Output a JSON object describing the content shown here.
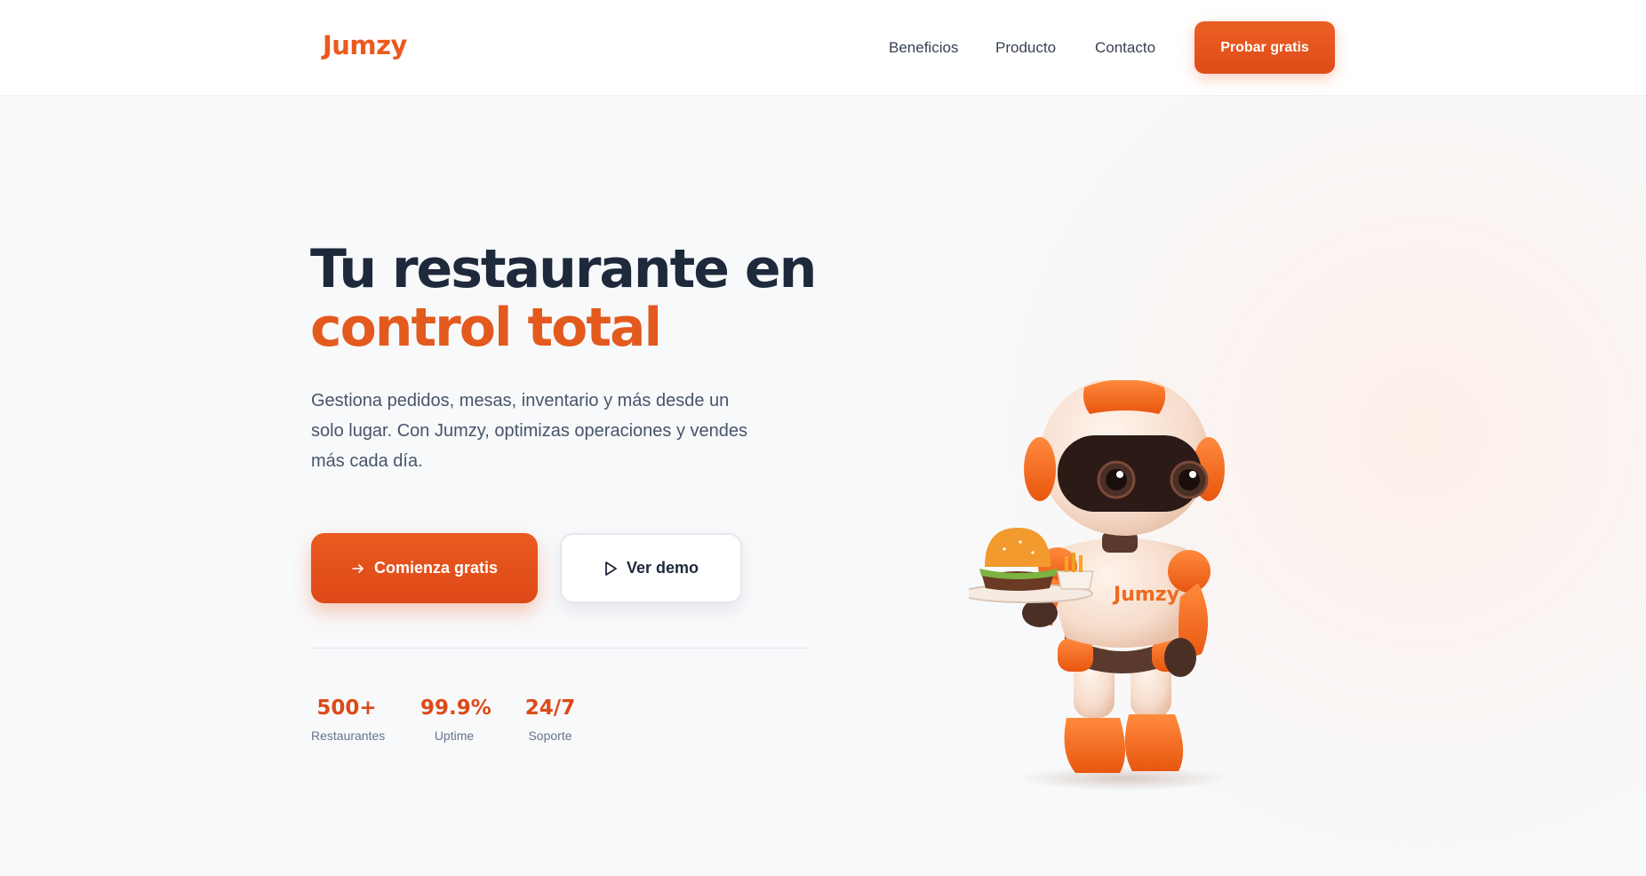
{
  "brand": {
    "name": "Jumzy",
    "accent_color": "#ea5a1f"
  },
  "nav": {
    "links": [
      "Beneficios",
      "Producto",
      "Contacto"
    ],
    "cta_label": "Probar gratis"
  },
  "hero": {
    "title_line1": "Tu restaurante en",
    "title_line2": "control total",
    "description": "Gestiona pedidos, mesas, inventario y más desde un solo lugar. Con Jumzy, optimizas operaciones y vendes más cada día.",
    "primary_button": {
      "label": "Comienza gratis",
      "icon": "arrow-right-icon"
    },
    "secondary_button": {
      "label": "Ver demo",
      "icon": "play-icon"
    },
    "stats": [
      {
        "value": "500+",
        "label": "Restaurantes"
      },
      {
        "value": "99.9%",
        "label": "Uptime"
      },
      {
        "value": "24/7",
        "label": "Soporte"
      }
    ],
    "illustration": {
      "subject": "robot-mascot",
      "chest_text": "Jumzy"
    }
  }
}
